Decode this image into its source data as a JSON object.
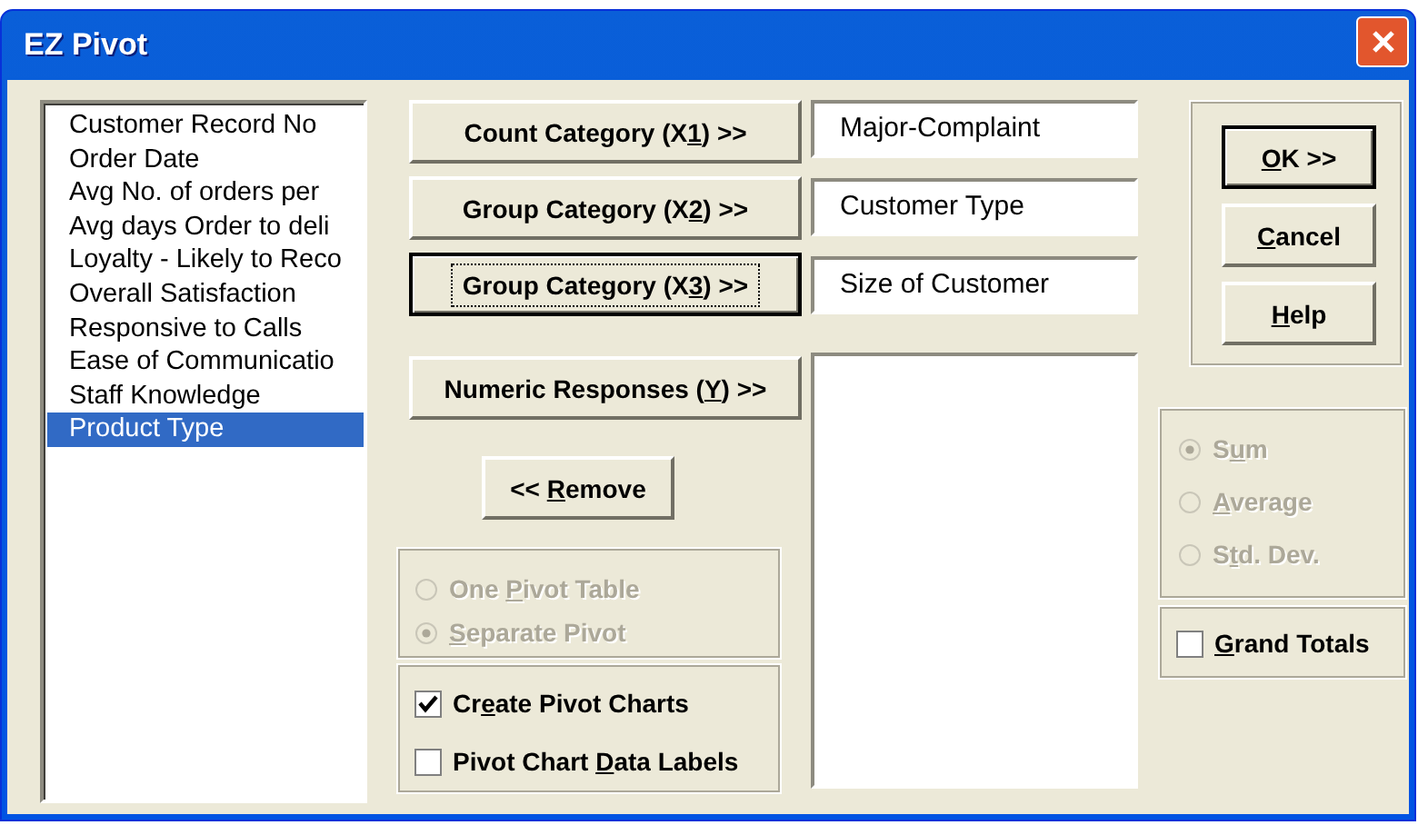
{
  "window": {
    "title": "EZ Pivot"
  },
  "variables": [
    {
      "label": "Customer Record No",
      "selected": false
    },
    {
      "label": "Order Date",
      "selected": false
    },
    {
      "label": "Avg No. of orders per",
      "selected": false
    },
    {
      "label": "Avg days Order to deli",
      "selected": false
    },
    {
      "label": "Loyalty - Likely to Reco",
      "selected": false
    },
    {
      "label": "Overall Satisfaction",
      "selected": false
    },
    {
      "label": "Responsive to Calls",
      "selected": false
    },
    {
      "label": "Ease of Communicatio",
      "selected": false
    },
    {
      "label": "Staff Knowledge",
      "selected": false
    },
    {
      "label": "Product Type",
      "selected": true
    }
  ],
  "assign_buttons": [
    {
      "pre": "Count Category (X",
      "key": "1",
      "post": ") >>",
      "focused": false
    },
    {
      "pre": "Group Category (X",
      "key": "2",
      "post": ") >>",
      "focused": false
    },
    {
      "pre": "Group Category (X",
      "key": "3",
      "post": ") >>",
      "focused": true
    },
    {
      "pre": "Numeric Responses (",
      "key": "Y",
      "post": ") >>",
      "focused": false
    }
  ],
  "assigned_fields": [
    {
      "value": "Major-Complaint"
    },
    {
      "value": "Customer Type"
    },
    {
      "value": "Size of Customer"
    }
  ],
  "remove_button": {
    "pre": "<< ",
    "key": "R",
    "post": "emove"
  },
  "pivot_options": [
    {
      "pre": "One ",
      "key": "P",
      "post": "ivot Table",
      "selected": false,
      "disabled": true
    },
    {
      "key": "S",
      "post": "eparate Pivot",
      "selected": true,
      "disabled": true
    }
  ],
  "chart_options": [
    {
      "pre": "Cr",
      "key": "e",
      "post": "ate Pivot Charts",
      "checked": true
    },
    {
      "pre": "Pivot Chart ",
      "key": "D",
      "post": "ata Labels",
      "checked": false
    }
  ],
  "dialog_buttons": [
    {
      "key": "O",
      "post": "K >>",
      "default": true
    },
    {
      "key": "C",
      "post": "ancel",
      "default": false
    },
    {
      "key": "H",
      "post": "elp",
      "default": false
    }
  ],
  "statistics": [
    {
      "pre": "S",
      "key": "u",
      "post": "m",
      "selected": true,
      "disabled": true
    },
    {
      "key": "A",
      "post": "verage",
      "selected": false,
      "disabled": true
    },
    {
      "pre": "S",
      "key": "t",
      "post": "d. Dev.",
      "selected": false,
      "disabled": true
    }
  ],
  "grand_totals": {
    "key": "G",
    "post": "rand Totals",
    "checked": false
  }
}
